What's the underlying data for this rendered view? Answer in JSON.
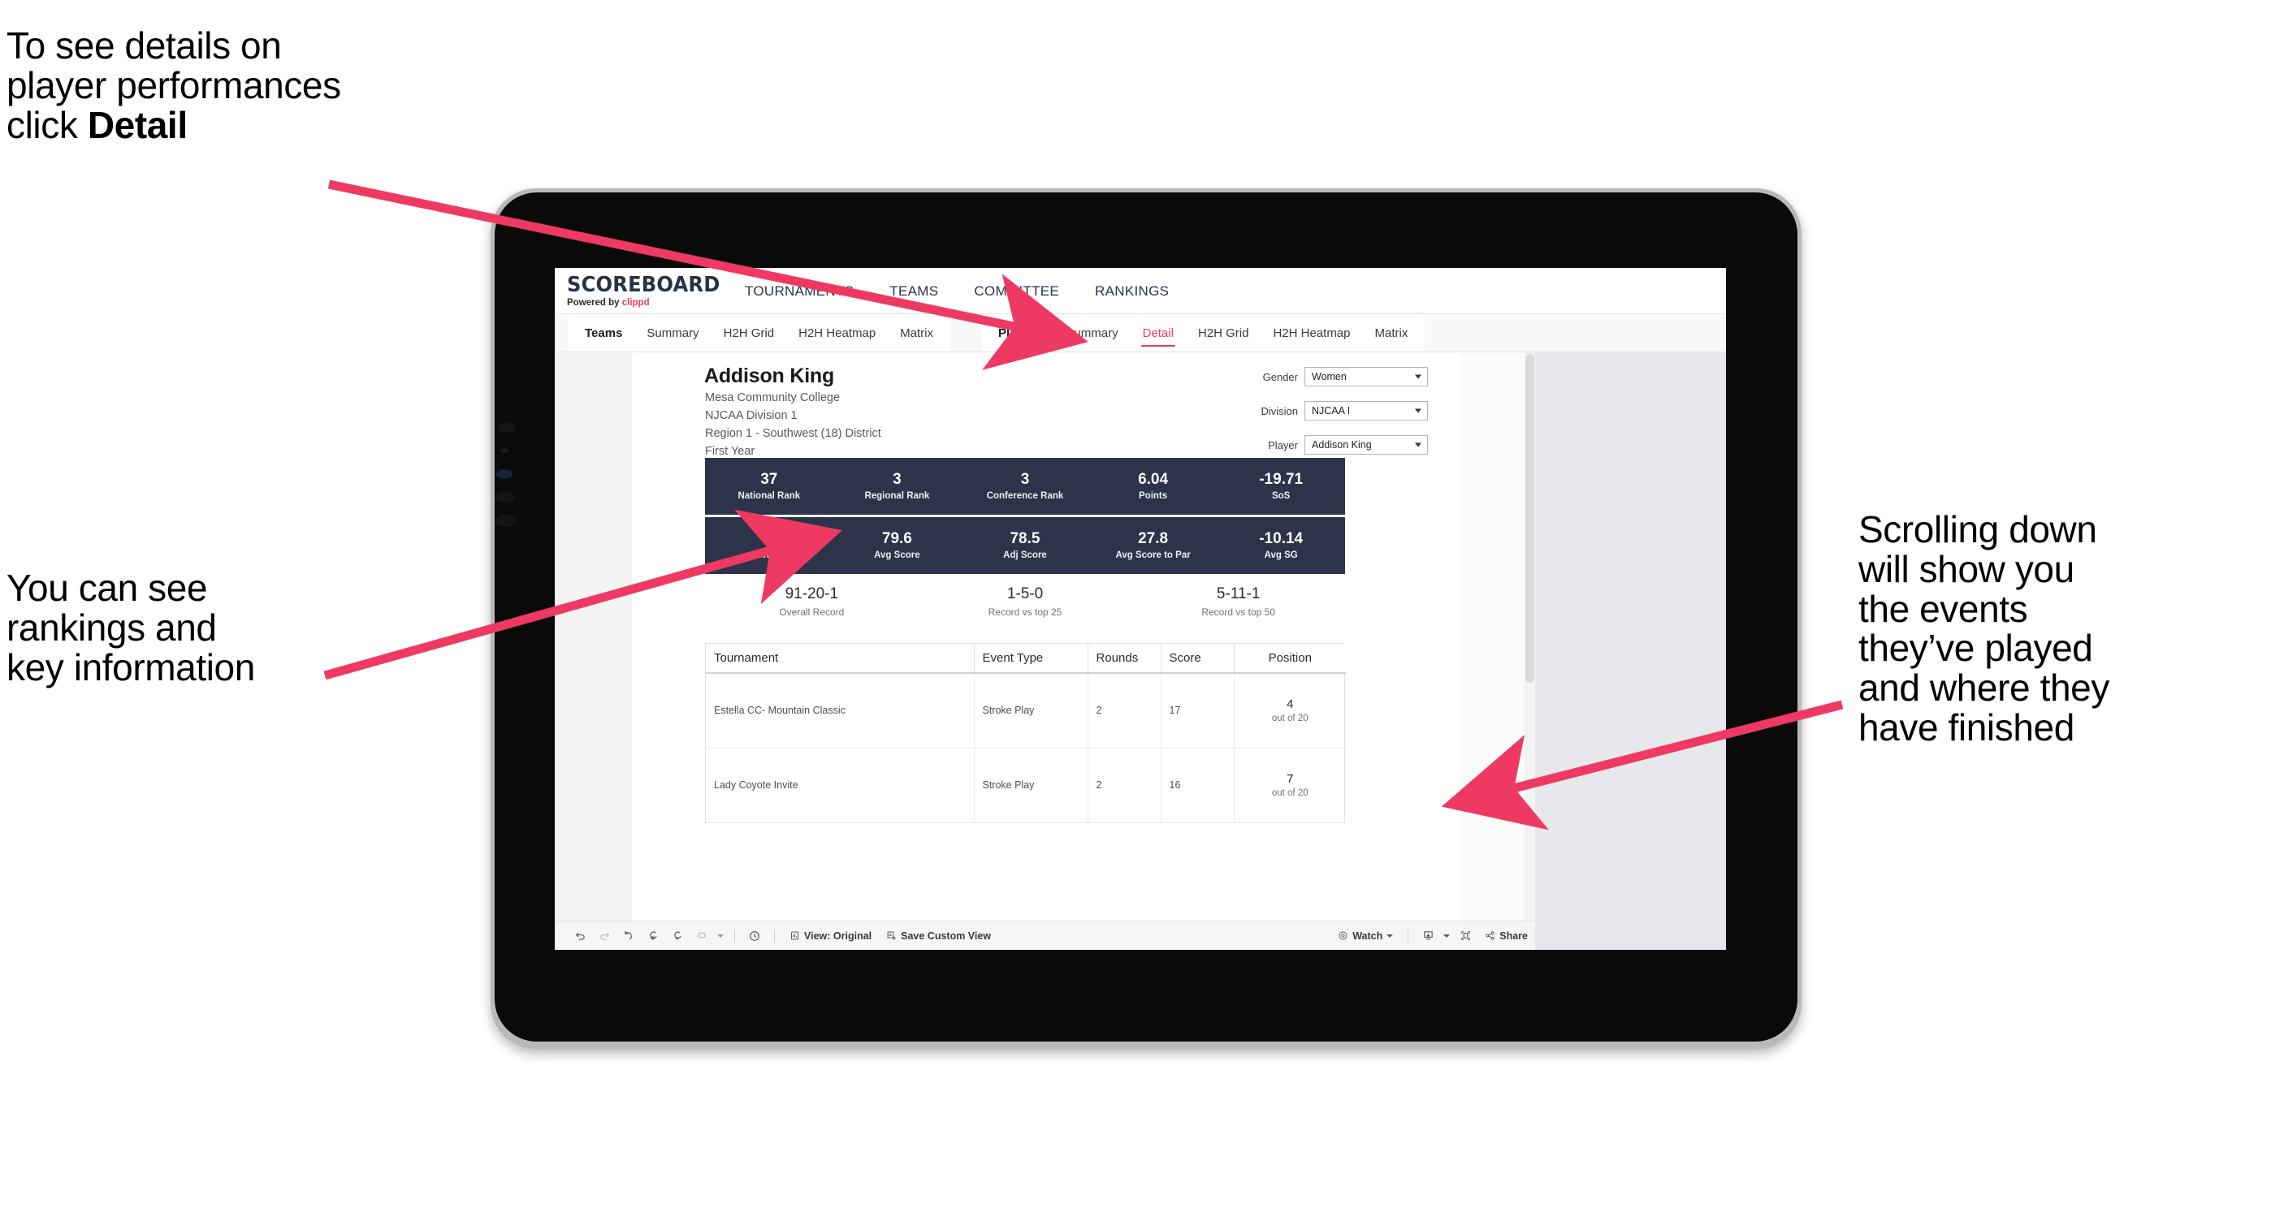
{
  "annotations": {
    "top_left": {
      "line1": "To see details on",
      "line2": "player performances",
      "line3_prefix": "click ",
      "line3_bold": "Detail"
    },
    "mid_left": {
      "line1": "You can see",
      "line2": "rankings and",
      "line3": "key information"
    },
    "right": {
      "line1": "Scrolling down",
      "line2": "will show you",
      "line3": "the events",
      "line4": "they’ve played",
      "line5": "and where they",
      "line6": "have finished"
    },
    "arrow_color": "#ee3a63"
  },
  "app": {
    "logo": {
      "main": "SCOREBOARD",
      "powered_prefix": "Powered by ",
      "brand": "clippd"
    },
    "top_nav": [
      "TOURNAMENTS",
      "TEAMS",
      "COMMITTEE",
      "RANKINGS"
    ],
    "sub_nav": {
      "teams_group": [
        "Teams",
        "Summary",
        "H2H Grid",
        "H2H Heatmap",
        "Matrix"
      ],
      "players_group": [
        "Players",
        "Summary",
        "Detail",
        "H2H Grid",
        "H2H Heatmap",
        "Matrix"
      ],
      "active_tab": "Detail",
      "accent_color": "#ef3c5f"
    }
  },
  "player": {
    "name": "Addison King",
    "school": "Mesa Community College",
    "division_text": "NJCAA Division 1",
    "region": "Region 1 - Southwest (18) District",
    "year": "First Year"
  },
  "filters": [
    {
      "label": "Gender",
      "value": "Women"
    },
    {
      "label": "Division",
      "value": "NJCAA I"
    },
    {
      "label": "Player",
      "value": "Addison King"
    }
  ],
  "stats_row_1": [
    {
      "value": "37",
      "label": "National Rank"
    },
    {
      "value": "3",
      "label": "Regional Rank"
    },
    {
      "value": "3",
      "label": "Conference Rank"
    },
    {
      "value": "6.04",
      "label": "Points"
    },
    {
      "value": "-19.71",
      "label": "SoS"
    }
  ],
  "stats_row_2": [
    {
      "value": "0",
      "label": "Wins"
    },
    {
      "value": "79.6",
      "label": "Avg Score"
    },
    {
      "value": "78.5",
      "label": "Adj Score"
    },
    {
      "value": "27.8",
      "label": "Avg Score to Par"
    },
    {
      "value": "-10.14",
      "label": "Avg SG"
    }
  ],
  "records": [
    {
      "value": "91-20-1",
      "label": "Overall Record"
    },
    {
      "value": "1-5-0",
      "label": "Record vs top 25"
    },
    {
      "value": "5-11-1",
      "label": "Record vs top 50"
    }
  ],
  "tournament_table": {
    "headers": [
      "Tournament",
      "Event Type",
      "Rounds",
      "Score",
      "Position"
    ],
    "rows": [
      {
        "tournament": "Estella CC- Mountain Classic",
        "event_type": "Stroke Play",
        "rounds": "2",
        "score": "17",
        "position_main": "4",
        "position_sub": "out of 20"
      },
      {
        "tournament": "Lady Coyote Invite",
        "event_type": "Stroke Play",
        "rounds": "2",
        "score": "16",
        "position_main": "7",
        "position_sub": "out of 20"
      }
    ]
  },
  "toolbar": {
    "view_original": "View: Original",
    "save_custom_view": "Save Custom View",
    "watch": "Watch",
    "share": "Share"
  },
  "colors": {
    "stat_bar_navy": "#2d3349",
    "accent_pink": "#ef3c5f",
    "dashboard_bg": "#e6e8eb"
  }
}
